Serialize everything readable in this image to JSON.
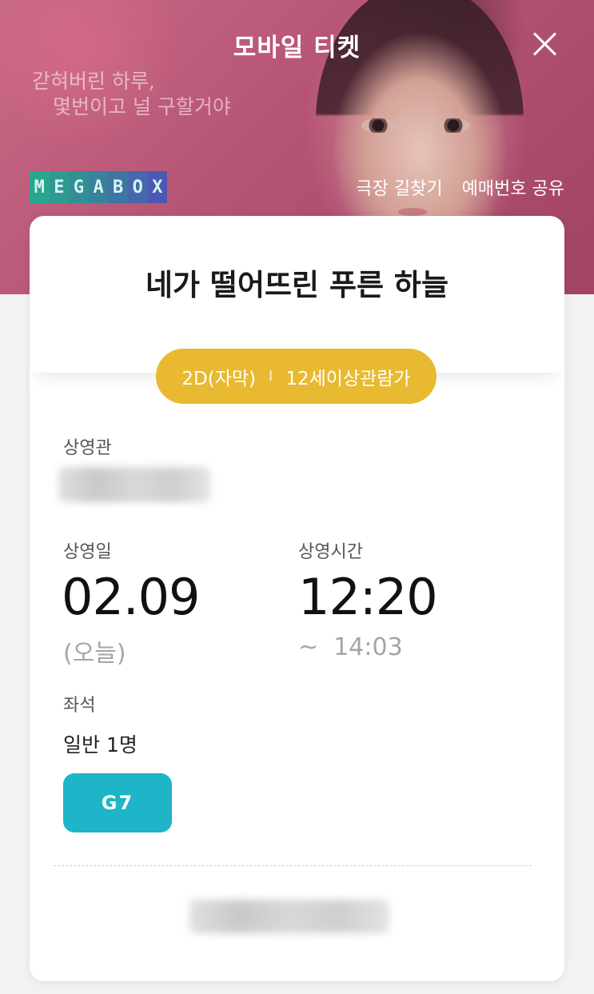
{
  "header": {
    "title": "모바일 티켓",
    "close_icon": "close-icon"
  },
  "poster": {
    "tagline": [
      "갇혀버린 하루,",
      "몇번이고 널 구할거야"
    ]
  },
  "brand": {
    "logo_letters": [
      "M",
      "E",
      "G",
      "A",
      "B",
      "O",
      "X"
    ]
  },
  "links": {
    "directions": "극장 길찾기",
    "share_booking": "예매번호 공유"
  },
  "ticket": {
    "movie_title": "네가 떨어뜨린 푸른 하늘",
    "format": "2D(자막)",
    "separator": "I",
    "rating": "12세이상관람가",
    "theater_label": "상영관",
    "date_label": "상영일",
    "date": "02.09",
    "date_note": "(오늘)",
    "time_label": "상영시간",
    "start_time": "12:20",
    "end_time": "~  14:03",
    "seat_label": "좌석",
    "seat_desc": "일반 1명",
    "seat_no": "G7"
  },
  "colors": {
    "accent_yellow": "#e8b931",
    "seat_teal": "#1db5c7"
  }
}
